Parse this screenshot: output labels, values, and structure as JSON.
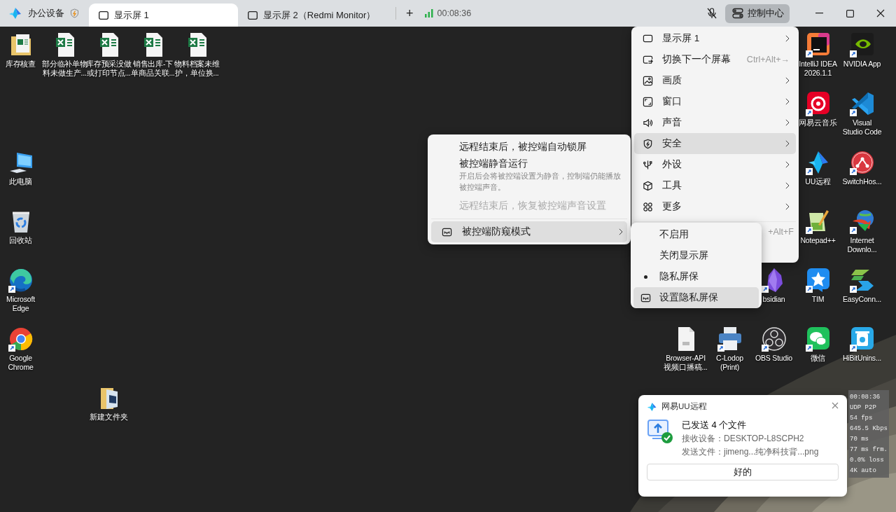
{
  "title_bar": {
    "device_tab": {
      "label": "办公设备"
    },
    "tabs": [
      {
        "label": "显示屏 1",
        "selected": true
      },
      {
        "label": "显示屏 2（Redmi Monitor）",
        "selected": false
      }
    ],
    "add_tab": "+",
    "session_time": "00:08:36",
    "mic_muted": true,
    "control_center": {
      "label": "控制中心"
    }
  },
  "desktop": {
    "top_row": [
      {
        "lines": [
          "库存核查"
        ],
        "kind": "xls-folder",
        "shortcut": false
      },
      {
        "lines": [
          "部分临补单物",
          "料未做生产..."
        ],
        "kind": "excel",
        "shortcut": false
      },
      {
        "lines": [
          "库存预采没做",
          "或打印节点..."
        ],
        "kind": "excel",
        "shortcut": false
      },
      {
        "lines": [
          "销售出库-下",
          "单商品关联..."
        ],
        "kind": "excel",
        "shortcut": false
      },
      {
        "lines": [
          "物料档案未维",
          "护，单位换..."
        ],
        "kind": "excel",
        "shortcut": false
      }
    ],
    "left_column": [
      {
        "lines": [
          "此电脑"
        ],
        "kind": "computer",
        "shortcut": false
      },
      {
        "lines": [
          "回收站"
        ],
        "kind": "recycle",
        "shortcut": false
      },
      {
        "lines": [
          "Microsoft",
          "Edge"
        ],
        "kind": "edge",
        "shortcut": true
      },
      {
        "lines": [
          "Google",
          "Chrome"
        ],
        "kind": "chrome",
        "shortcut": true
      }
    ],
    "loose": [
      {
        "lines": [
          "新建文件夹"
        ],
        "kind": "folder",
        "shortcut": false
      }
    ],
    "right_rows": [
      [
        {
          "lines": [
            "IntelliJ IDEA",
            "2026.1.1"
          ],
          "kind": "intellij",
          "shortcut": true
        },
        {
          "lines": [
            "NVIDIA App"
          ],
          "kind": "nvidia",
          "shortcut": true
        }
      ],
      [
        {
          "lines": [
            "网易云音乐"
          ],
          "kind": "netease",
          "shortcut": true
        },
        {
          "lines": [
            "Visual",
            "Studio Code"
          ],
          "kind": "vscode",
          "shortcut": true
        }
      ],
      [
        {
          "lines": [
            "UU远程"
          ],
          "kind": "uu",
          "shortcut": true
        },
        {
          "lines": [
            "SwitchHos..."
          ],
          "kind": "switchhosts",
          "shortcut": true
        }
      ],
      [
        {
          "lines": [
            "Notepad++"
          ],
          "kind": "notepad",
          "shortcut": true
        },
        {
          "lines": [
            "Internet",
            "Downlo..."
          ],
          "kind": "idm",
          "shortcut": true
        }
      ],
      [
        {
          "lines": [
            "bsidian"
          ],
          "kind": "obsidian",
          "shortcut": true
        },
        {
          "lines": [
            "TIM"
          ],
          "kind": "tim",
          "shortcut": true
        },
        {
          "lines": [
            "EasyConn..."
          ],
          "kind": "easyconnect",
          "shortcut": true
        }
      ],
      [
        {
          "lines": [
            "Browser-API",
            "视频口播稿..."
          ],
          "kind": "document",
          "shortcut": false
        },
        {
          "lines": [
            "C-Lodop",
            "(Print)"
          ],
          "kind": "printer",
          "shortcut": true
        },
        {
          "lines": [
            "OBS Studio"
          ],
          "kind": "obs",
          "shortcut": true
        },
        {
          "lines": [
            "微信"
          ],
          "kind": "wechat",
          "shortcut": true
        },
        {
          "lines": [
            "HiBitUnins..."
          ],
          "kind": "hibit",
          "shortcut": true
        }
      ]
    ]
  },
  "main_menu": {
    "items": [
      {
        "label": "显示屏 1",
        "kind": "monitor",
        "submenu": true,
        "highlighted": false
      },
      {
        "label": "切换下一个屏幕",
        "kind": "switch",
        "shortcut": "Ctrl+Alt+→",
        "submenu": false,
        "highlighted": false
      },
      {
        "label": "画质",
        "kind": "quality",
        "submenu": true,
        "highlighted": false
      },
      {
        "label": "窗口",
        "kind": "window",
        "submenu": true,
        "highlighted": false
      },
      {
        "label": "声音",
        "kind": "sound",
        "submenu": true,
        "highlighted": false
      },
      {
        "label": "安全",
        "kind": "shield",
        "submenu": true,
        "highlighted": true
      },
      {
        "label": "外设",
        "kind": "usb",
        "submenu": true,
        "highlighted": false
      },
      {
        "label": "工具",
        "kind": "cube",
        "submenu": true,
        "highlighted": false
      },
      {
        "label": "更多",
        "kind": "apps",
        "submenu": true,
        "highlighted": false
      }
    ],
    "partly_hidden_shortcut": "+Alt+F"
  },
  "security_menu": {
    "items": [
      {
        "label": "远程结束后，被控端自动锁屏",
        "kind": "plain",
        "disabled": false,
        "highlighted": false,
        "submenu": false
      },
      {
        "label": "被控端静音运行",
        "description": [
          "开启后会将被控端设置为静音，控制端仍能播放",
          "被控端声音。"
        ],
        "kind": "plain",
        "disabled": false,
        "highlighted": false,
        "submenu": false
      },
      {
        "label": "远程结束后，恢复被控端声音设置",
        "kind": "plain",
        "disabled": true,
        "highlighted": false,
        "submenu": false
      },
      {
        "kind": "separator"
      },
      {
        "label": "被控端防窥模式",
        "kind": "privacy",
        "disabled": false,
        "highlighted": true,
        "submenu": true
      }
    ]
  },
  "privacy_menu": {
    "items": [
      {
        "label": "不启用",
        "kind": "radio",
        "selected": false,
        "highlighted": false
      },
      {
        "label": "关闭显示屏",
        "kind": "radio",
        "selected": false,
        "highlighted": false
      },
      {
        "label": "隐私屏保",
        "kind": "radio",
        "selected": true,
        "highlighted": false
      },
      {
        "label": "设置隐私屏保",
        "kind": "privacy",
        "highlighted": true
      }
    ]
  },
  "notification": {
    "app_name": "网易UU远程",
    "title": "已发送 4 个文件",
    "lines": [
      "接收设备：DESKTOP-L8SCPH2",
      "发送文件：jimeng...纯净科技背...png"
    ],
    "button": "好的"
  },
  "stats_overlay": {
    "lines": [
      "00:08:36",
      "UDP P2P",
      "54 fps",
      "645.5 Kbps",
      "70 ms",
      "77 ms frm.",
      "0.0% loss",
      "4K auto"
    ]
  }
}
